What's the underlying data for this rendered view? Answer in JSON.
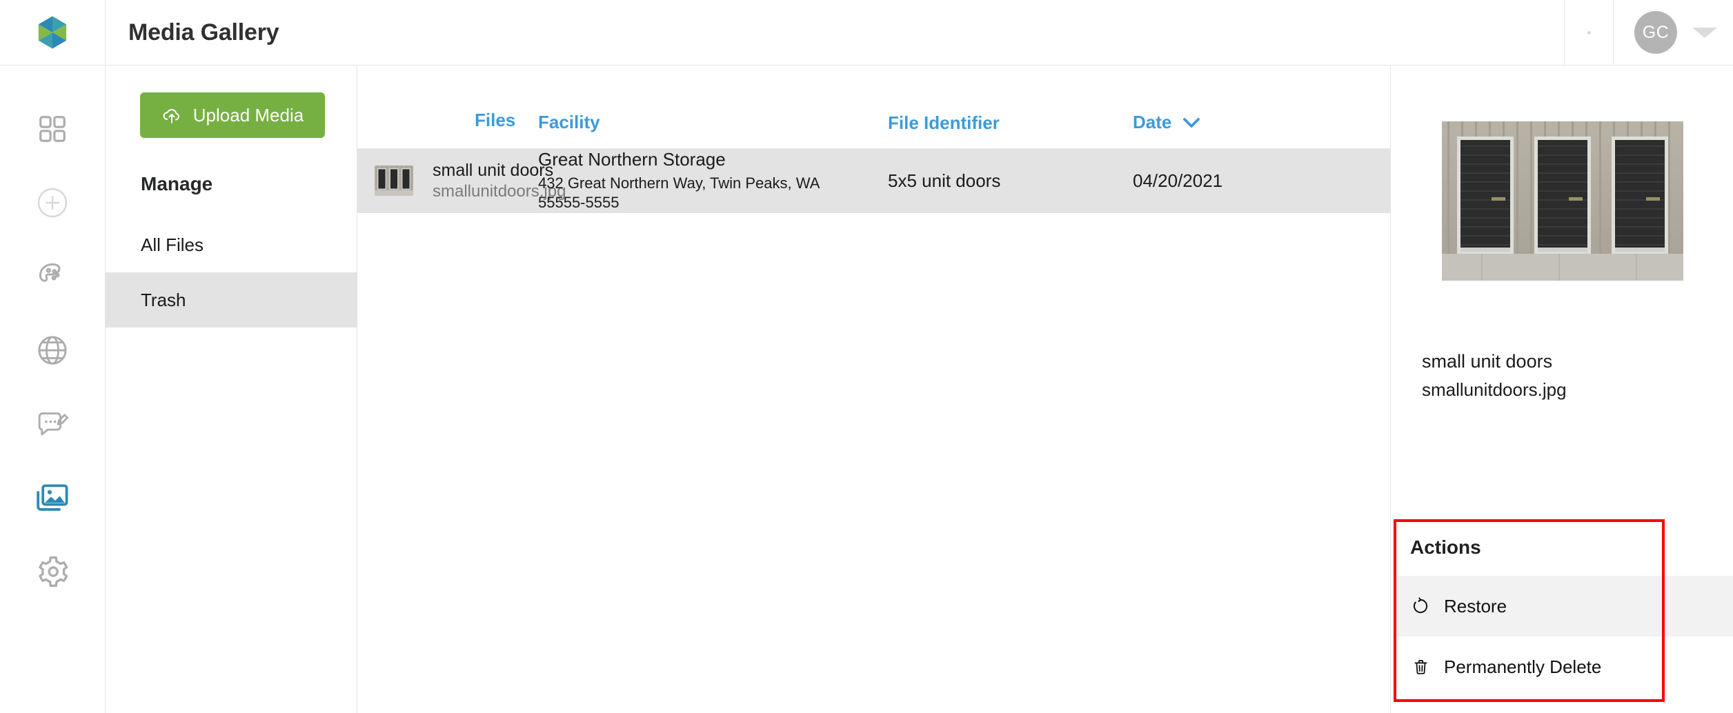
{
  "brand": {
    "logo_icon": "cube-logo-icon",
    "colors": {
      "cube_blue": "#2c89b5",
      "cube_teal": "#3c9fae",
      "cube_green": "#86b848",
      "accent_link": "#3d9ad8",
      "upload_green": "#76b043",
      "annotation_red": "#ff0000",
      "row_highlight": "#e3e3e3"
    }
  },
  "header": {
    "title": "Media Gallery",
    "user": {
      "initials": "GC",
      "caret_icon": "caret-down-icon"
    }
  },
  "rail": {
    "items": [
      {
        "icon": "grid-icon",
        "name": "dashboard",
        "active": false
      },
      {
        "icon": "plus-circle-icon",
        "name": "add",
        "active": false
      },
      {
        "icon": "palette-icon",
        "name": "branding",
        "active": false
      },
      {
        "icon": "globe-icon",
        "name": "website",
        "active": false
      },
      {
        "icon": "chat-edit-icon",
        "name": "messages",
        "active": false
      },
      {
        "icon": "media-gallery-icon",
        "name": "media-gallery",
        "active": true
      },
      {
        "icon": "gear-icon",
        "name": "settings",
        "active": false
      }
    ]
  },
  "manage": {
    "upload_label": "Upload Media",
    "upload_icon": "cloud-upload-icon",
    "heading": "Manage",
    "items": [
      {
        "label": "All Files",
        "active": false
      },
      {
        "label": "Trash",
        "active": true
      }
    ]
  },
  "table": {
    "columns": [
      {
        "label": "Files",
        "sorted": false
      },
      {
        "label": "Facility",
        "sorted": false
      },
      {
        "label": "File Identifier",
        "sorted": false
      },
      {
        "label": "Date",
        "sorted": true,
        "sort_icon": "chevron-down-icon",
        "sort_glyph": "⌄"
      }
    ],
    "rows": [
      {
        "thumbnail": "storage-unit-doors-thumbnail",
        "file_title": "small unit doors",
        "file_name": "smallunitdoors.jpg",
        "facility_name": "Great Northern Storage",
        "facility_address": "432 Great Northern Way, Twin Peaks, WA 55555-5555",
        "file_identifier": "5x5 unit doors",
        "date": "04/20/2021",
        "selected": true
      }
    ]
  },
  "detail": {
    "preview_alt": "storage-unit-doors-preview",
    "title": "small unit doors",
    "file_name": "smallunitdoors.jpg",
    "actions": {
      "heading": "Actions",
      "items": [
        {
          "label": "Restore",
          "icon": "restore-icon",
          "highlighted": true
        },
        {
          "label": "Permanently Delete",
          "icon": "trash-icon",
          "highlighted": false
        }
      ]
    }
  }
}
